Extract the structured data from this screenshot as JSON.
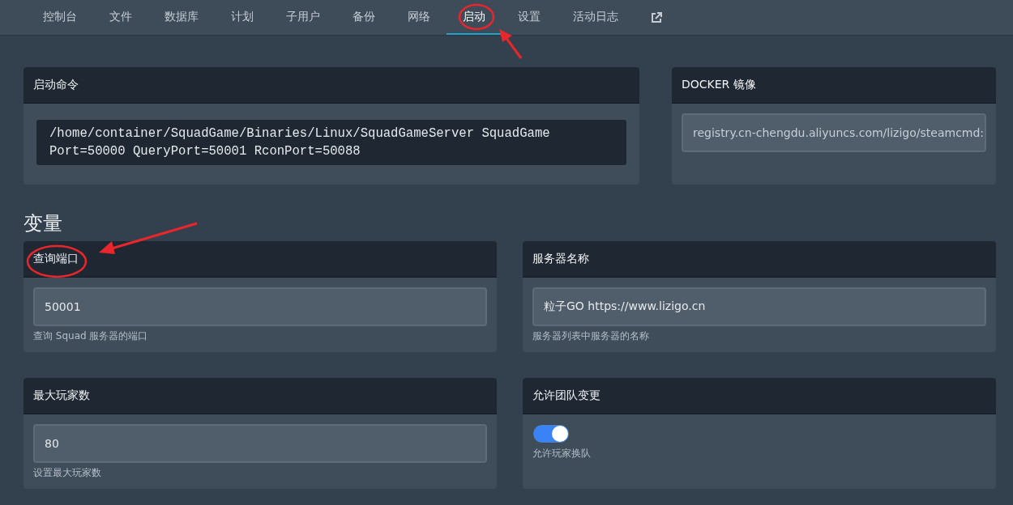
{
  "nav": {
    "tabs": [
      {
        "label": "控制台",
        "selected": false
      },
      {
        "label": "文件",
        "selected": false
      },
      {
        "label": "数据库",
        "selected": false
      },
      {
        "label": "计划",
        "selected": false
      },
      {
        "label": "子用户",
        "selected": false
      },
      {
        "label": "备份",
        "selected": false
      },
      {
        "label": "网络",
        "selected": false
      },
      {
        "label": "启动",
        "selected": true
      },
      {
        "label": "设置",
        "selected": false
      },
      {
        "label": "活动日志",
        "selected": false
      }
    ]
  },
  "startup_command": {
    "title": "启动命令",
    "command": "/home/container/SquadGame/Binaries/Linux/SquadGameServer SquadGame Port=50000 QueryPort=50001 RconPort=50088"
  },
  "docker_image": {
    "title": "DOCKER 镜像",
    "value": "registry.cn-chengdu.aliyuncs.com/lizigo/steamcmd:"
  },
  "variables_heading": "变量",
  "variables": [
    {
      "kind": "text",
      "title": "查询端口",
      "value": "50001",
      "description": "查询 Squad 服务器的端口"
    },
    {
      "kind": "text",
      "title": "服务器名称",
      "value": "粒子GO https://www.lizigo.cn",
      "description": "服务器列表中服务器的名称"
    },
    {
      "kind": "text",
      "title": "最大玩家数",
      "value": "80",
      "description": "设置最大玩家数"
    },
    {
      "kind": "toggle",
      "title": "允许团队变更",
      "on": true,
      "description": "允许玩家换队"
    }
  ]
}
